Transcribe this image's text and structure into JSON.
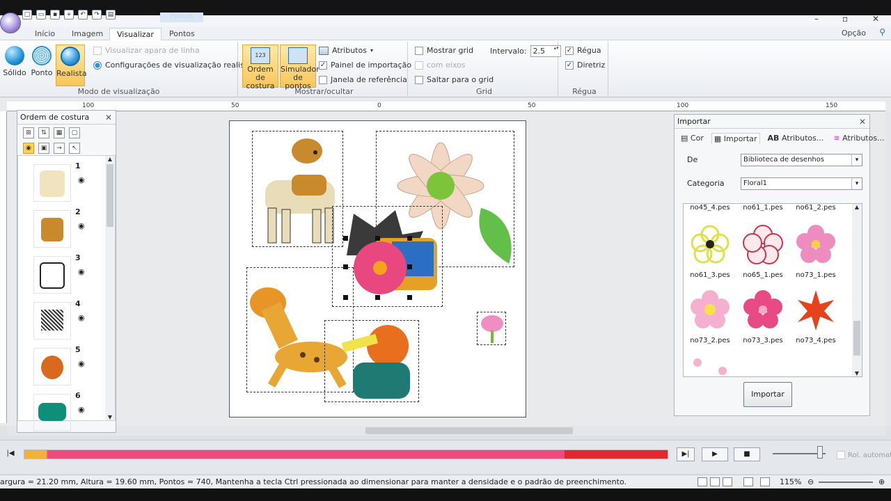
{
  "tabs": [
    {
      "label": "Início"
    },
    {
      "label": "Imagem"
    },
    {
      "label": "Visualizar",
      "active": true
    },
    {
      "label": "Pontos"
    }
  ],
  "contextual_tab": "Pontos",
  "opcao_label": "Opção",
  "ribbon": {
    "modo": {
      "title": "Modo de visualização",
      "buttons": [
        {
          "label": "Sólido"
        },
        {
          "label": "Ponto"
        },
        {
          "label": "Realista",
          "selected": true
        }
      ],
      "options": [
        {
          "label": "Visualizar apara de linha",
          "checked": false,
          "disabled": true
        },
        {
          "label": "Configurações de visualização realista"
        }
      ]
    },
    "mostrar": {
      "title": "Mostrar/ocultar",
      "btn_ordem": {
        "line1": "Ordem de",
        "line2": "costura"
      },
      "btn_simulador": {
        "line1": "Simulador",
        "line2": "de pontos"
      },
      "atributos": "Atributos",
      "checks": [
        {
          "label": "Painel de importação",
          "checked": true
        },
        {
          "label": "Janela de referência",
          "checked": false
        }
      ]
    },
    "grid": {
      "title": "Grid",
      "mostrar_grid": "Mostrar grid",
      "intervalo_label": "Intervalo:",
      "intervalo_value": "2.5",
      "com_eixos": "com eixos",
      "saltar": "Saltar para o grid"
    },
    "regua": {
      "title": "Régua",
      "checks": [
        {
          "label": "Régua",
          "checked": true
        },
        {
          "label": "Diretriz",
          "checked": true
        }
      ]
    }
  },
  "ruler": {
    "labels": [
      "100",
      "50",
      "0",
      "50",
      "100",
      "150"
    ]
  },
  "sequence_panel": {
    "title": "Ordem de costura",
    "items": [
      {
        "num": "1",
        "color": "#efe3c0"
      },
      {
        "num": "2",
        "color": "#c98a2e"
      },
      {
        "num": "3",
        "color": "#ffffff"
      },
      {
        "num": "4",
        "color": "#3a3a3a"
      },
      {
        "num": "5",
        "color": "#d96a1d"
      },
      {
        "num": "6",
        "color": "#0f8f7a"
      }
    ]
  },
  "import_panel": {
    "title": "Importar",
    "tabs": [
      {
        "label": "Cor"
      },
      {
        "label": "Importar",
        "active": true
      },
      {
        "label": "Atributos..."
      },
      {
        "label": "Atributos..."
      }
    ],
    "de_label": "De",
    "de_value": "Biblioteca de desenhos",
    "categoria_label": "Categoria",
    "categoria_value": "Floral1",
    "top_row": [
      "no45_4.pes",
      "no61_1.pes",
      "no61_2.pes"
    ],
    "items": [
      {
        "name": "no61_3.pes",
        "color": "#e8e85a"
      },
      {
        "name": "no65_1.pes",
        "color": "#c7354e"
      },
      {
        "name": "no73_1.pes",
        "color": "#ee8cc0"
      },
      {
        "name": "no73_2.pes",
        "color": "#f6b0cf"
      },
      {
        "name": "no73_3.pes",
        "color": "#e84a86"
      },
      {
        "name": "no73_4.pes",
        "color": "#e6421c"
      }
    ],
    "import_button": "Importar"
  },
  "playback": {
    "progress": 1.0,
    "rol_label": "Rol. automat."
  },
  "status": {
    "text": "argura = 21.20 mm, Altura = 19.60 mm, Pontos = 740, Mantenha a tecla Ctrl pressionada ao dimensionar para manter a densidade e o padrão de preenchimento.",
    "zoom": "115%"
  }
}
